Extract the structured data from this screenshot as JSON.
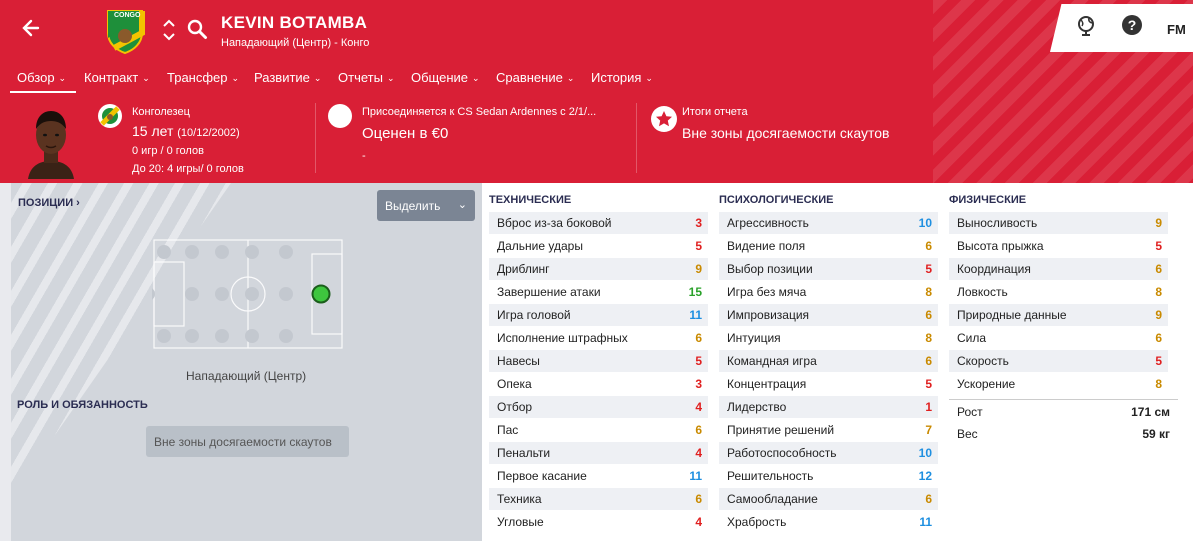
{
  "header": {
    "player_name": "KEVIN BOTAMBA",
    "subtitle": "Нападающий (Центр) - Конго",
    "fm_label": "FM",
    "crest_text": "CONGO"
  },
  "menu": [
    {
      "label": "Обзор"
    },
    {
      "label": "Контракт"
    },
    {
      "label": "Трансфер"
    },
    {
      "label": "Развитие"
    },
    {
      "label": "Отчеты"
    },
    {
      "label": "Общение"
    },
    {
      "label": "Сравнение"
    },
    {
      "label": "История"
    }
  ],
  "info": {
    "nationality": "Конголезец",
    "age": "15 лет",
    "dob": "(10/12/2002)",
    "games": "0 игр / 0 голов",
    "u20": "До 20: 4 игры/ 0 голов",
    "join": "Присоединяется к CS Sedan Ardennes с 2/1/...",
    "value": "Оценен в €0",
    "dash": "-",
    "report_title": "Итоги отчета",
    "report_text": "Вне зоны досягаемости скаутов"
  },
  "left": {
    "positions_title": "ПОЗИЦИИ",
    "select_label": "Выделить",
    "position_label": "Нападающий (Центр)",
    "role_title": "РОЛЬ И ОБЯЗАННОСТЬ",
    "scout_label": "Вне зоны досягаемости скаутов"
  },
  "attributes": {
    "technical": {
      "title": "ТЕХНИЧЕСКИЕ",
      "items": [
        {
          "name": "Вброс из-за боковой",
          "value": "3"
        },
        {
          "name": "Дальние удары",
          "value": "5"
        },
        {
          "name": "Дриблинг",
          "value": "9"
        },
        {
          "name": "Завершение атаки",
          "value": "15"
        },
        {
          "name": "Игра головой",
          "value": "11"
        },
        {
          "name": "Исполнение штрафных",
          "value": "6"
        },
        {
          "name": "Навесы",
          "value": "5"
        },
        {
          "name": "Опека",
          "value": "3"
        },
        {
          "name": "Отбор",
          "value": "4"
        },
        {
          "name": "Пас",
          "value": "6"
        },
        {
          "name": "Пенальти",
          "value": "4"
        },
        {
          "name": "Первое касание",
          "value": "11"
        },
        {
          "name": "Техника",
          "value": "6"
        },
        {
          "name": "Угловые",
          "value": "4"
        }
      ]
    },
    "mental": {
      "title": "ПСИХОЛОГИЧЕСКИЕ",
      "items": [
        {
          "name": "Агрессивность",
          "value": "10"
        },
        {
          "name": "Видение поля",
          "value": "6"
        },
        {
          "name": "Выбор позиции",
          "value": "5"
        },
        {
          "name": "Игра без мяча",
          "value": "8"
        },
        {
          "name": "Импровизация",
          "value": "6"
        },
        {
          "name": "Интуиция",
          "value": "8"
        },
        {
          "name": "Командная игра",
          "value": "6"
        },
        {
          "name": "Концентрация",
          "value": "5"
        },
        {
          "name": "Лидерство",
          "value": "1"
        },
        {
          "name": "Принятие решений",
          "value": "7"
        },
        {
          "name": "Работоспособность",
          "value": "10"
        },
        {
          "name": "Решительность",
          "value": "12"
        },
        {
          "name": "Самообладание",
          "value": "6"
        },
        {
          "name": "Храбрость",
          "value": "11"
        }
      ]
    },
    "physical": {
      "title": "ФИЗИЧЕСКИЕ",
      "items": [
        {
          "name": "Выносливость",
          "value": "9"
        },
        {
          "name": "Высота прыжка",
          "value": "5"
        },
        {
          "name": "Координация",
          "value": "6"
        },
        {
          "name": "Ловкость",
          "value": "8"
        },
        {
          "name": "Природные данные",
          "value": "9"
        },
        {
          "name": "Сила",
          "value": "6"
        },
        {
          "name": "Скорость",
          "value": "5"
        },
        {
          "name": "Ускорение",
          "value": "8"
        }
      ]
    },
    "height_label": "Рост",
    "height_value": "171 см",
    "weight_label": "Вес",
    "weight_value": "59 кг"
  },
  "colors": {
    "header_red": "#d91f36",
    "low": "#e02020",
    "mid": "#c98a00",
    "good": "#1e8fe0",
    "great": "#2aa12a"
  }
}
